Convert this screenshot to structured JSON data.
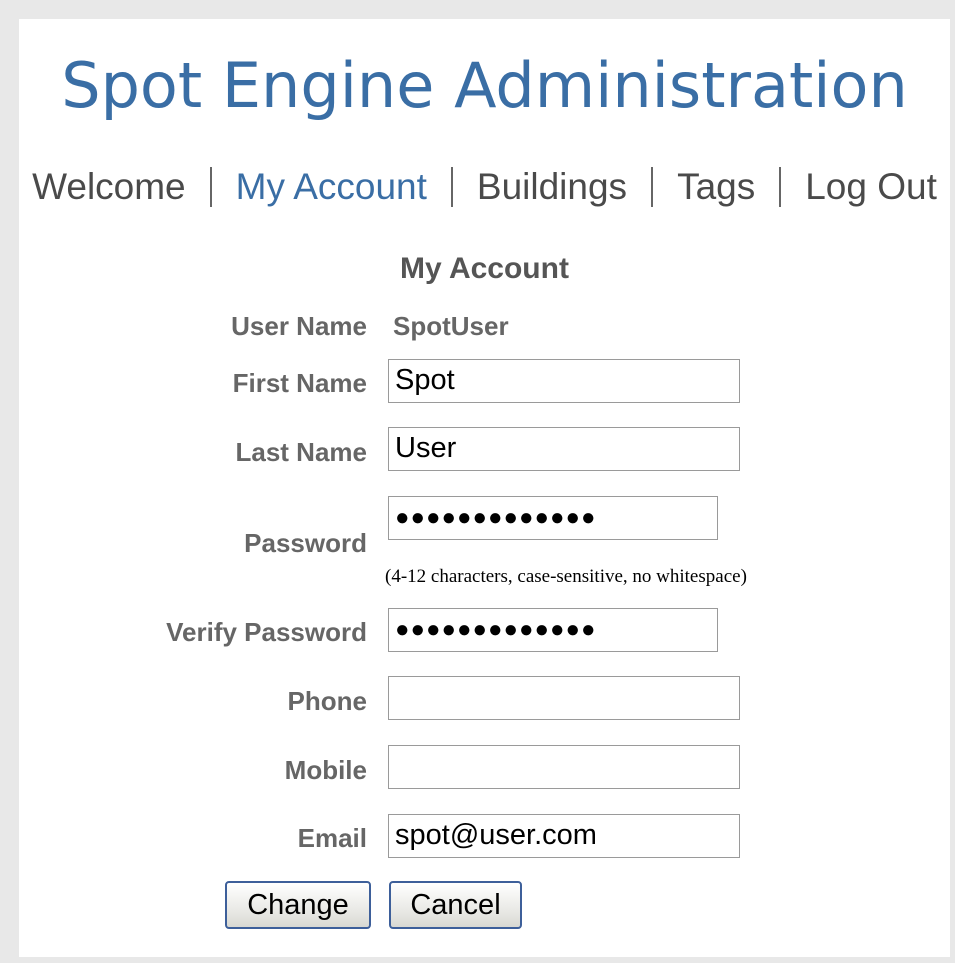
{
  "header": {
    "title": "Spot Engine Administration"
  },
  "nav": {
    "items": [
      {
        "label": "Welcome",
        "active": false
      },
      {
        "label": "My Account",
        "active": true
      },
      {
        "label": "Buildings",
        "active": false
      },
      {
        "label": "Tags",
        "active": false
      },
      {
        "label": "Log Out",
        "active": false
      }
    ]
  },
  "page": {
    "title": "My Account"
  },
  "form": {
    "user_name": {
      "label": "User Name",
      "value": "SpotUser"
    },
    "first_name": {
      "label": "First Name",
      "value": "Spot"
    },
    "last_name": {
      "label": "Last Name",
      "value": "User"
    },
    "password": {
      "label": "Password",
      "value": "●●●●●●●●●●●●●",
      "hint": "(4-12 characters, case-sensitive, no whitespace)"
    },
    "verify_password": {
      "label": "Verify Password",
      "value": "●●●●●●●●●●●●●"
    },
    "phone": {
      "label": "Phone",
      "value": ""
    },
    "mobile": {
      "label": "Mobile",
      "value": ""
    },
    "email": {
      "label": "Email",
      "value": "spot@user.com"
    }
  },
  "actions": {
    "change_label": "Change",
    "cancel_label": "Cancel"
  },
  "colors": {
    "title": "#3a6ea5",
    "active_nav": "#3a6ea5",
    "label": "#666666",
    "button_border": "#3d5f9a"
  }
}
